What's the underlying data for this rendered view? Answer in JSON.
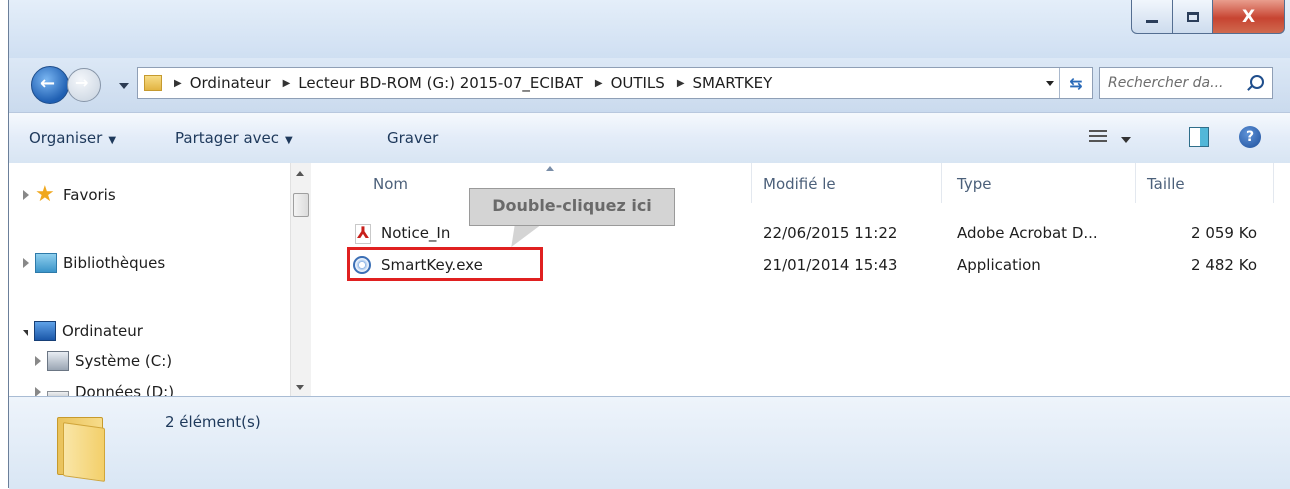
{
  "window": {
    "buttons": {
      "minimize": "minimize",
      "maximize": "maximize",
      "close": "close"
    }
  },
  "address": {
    "breadcrumbs": [
      "Ordinateur",
      "Lecteur BD-ROM (G:) 2015-07_ECIBAT",
      "OUTILS",
      "SMARTKEY"
    ]
  },
  "search": {
    "placeholder": "Rechercher da..."
  },
  "toolbar": {
    "organize_label": "Organiser",
    "share_label": "Partager avec",
    "burn_label": "Graver"
  },
  "navigation": {
    "favorites": "Favoris",
    "libraries": "Bibliothèques",
    "computer": "Ordinateur",
    "drive_c": "Système (C:)",
    "drive_d": "Données (D:)"
  },
  "columns": {
    "name": "Nom",
    "modified": "Modifié le",
    "type": "Type",
    "size": "Taille"
  },
  "files": [
    {
      "name": "Notice_In",
      "modified": "22/06/2015 11:22",
      "type": "Adobe Acrobat D...",
      "size": "2 059 Ko",
      "icon": "pdf-icon"
    },
    {
      "name": "SmartKey.exe",
      "modified": "21/01/2014 15:43",
      "type": "Application",
      "size": "2 482 Ko",
      "icon": "exe-icon"
    }
  ],
  "callout": {
    "text": "Double-cliquez ici"
  },
  "details": {
    "count": "2 élément(s)"
  },
  "colors": {
    "highlight": "#e02020",
    "callout_bg": "#d4d4d4"
  }
}
